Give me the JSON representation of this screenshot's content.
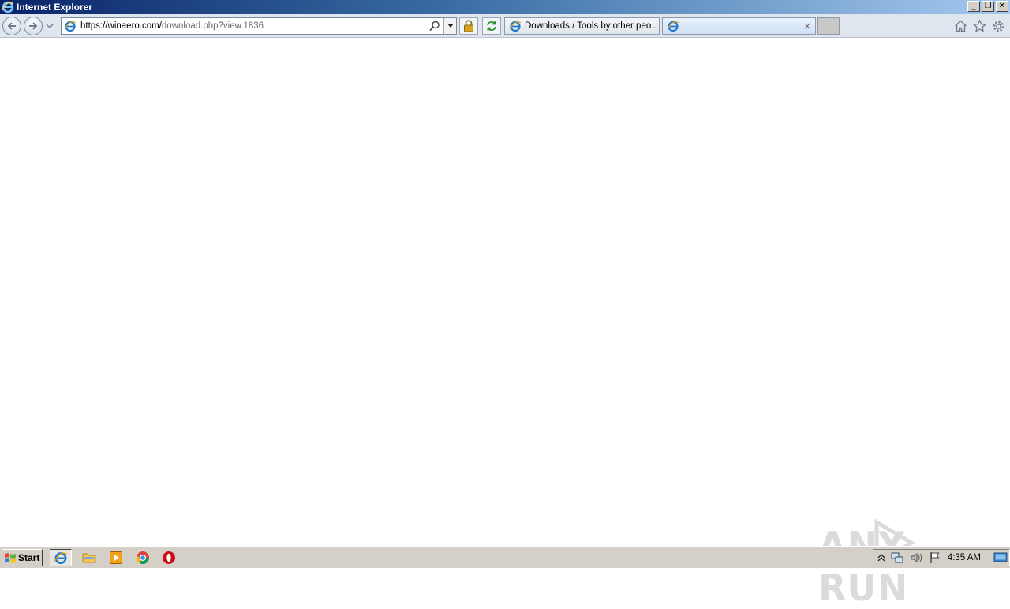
{
  "window": {
    "title": "Internet Explorer",
    "minimize": "_",
    "restore": "❐",
    "close": "✕"
  },
  "address": {
    "host": "https://winaero.com/",
    "path": "download.php?view.1836"
  },
  "tabs": [
    {
      "label": "Downloads / Tools by other peo...",
      "active": false
    },
    {
      "label": "",
      "active": true,
      "close": "×"
    }
  ],
  "watermark": {
    "text": "ANY RUN"
  },
  "taskbar": {
    "start_label": "Start",
    "clock": "4:35 AM"
  },
  "colors": {
    "titlebar_start": "#0a246a",
    "titlebar_end": "#a6caf0",
    "ie_blue": "#1e78d2",
    "lock_gold": "#d9a521",
    "refresh_green": "#2f8f2f",
    "opera_red": "#cc0f16"
  }
}
